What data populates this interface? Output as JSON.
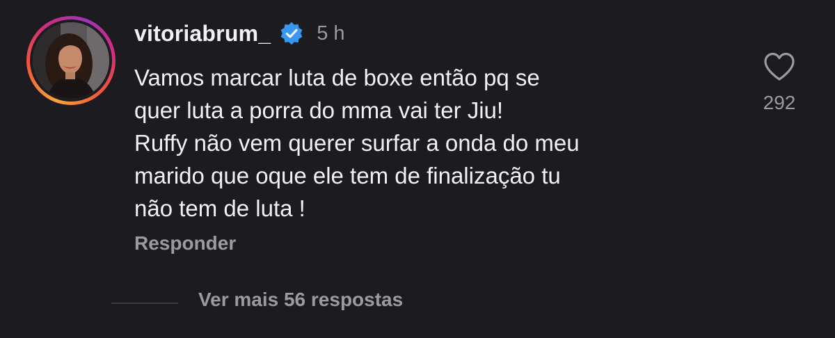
{
  "comment": {
    "username": "vitoriabrum_",
    "verified": true,
    "timestamp": "5 h",
    "text": "Vamos marcar luta de boxe então pq se\nquer luta a porra do mma vai ter Jiu!\nRuffy não vem querer surfar a onda do meu\nmarido que oque ele tem de finalização tu\nnão tem de luta !",
    "reply_label": "Responder",
    "like_count": "292",
    "view_replies_label": "Ver mais 56 respostas"
  },
  "icons": {
    "verified": "verified-badge-icon",
    "like": "heart-outline-icon"
  },
  "colors": {
    "background": "#1c1c20",
    "primary_text": "#f2f2f2",
    "secondary_text": "#9a9aa0",
    "verified_blue": "#3897f0"
  }
}
